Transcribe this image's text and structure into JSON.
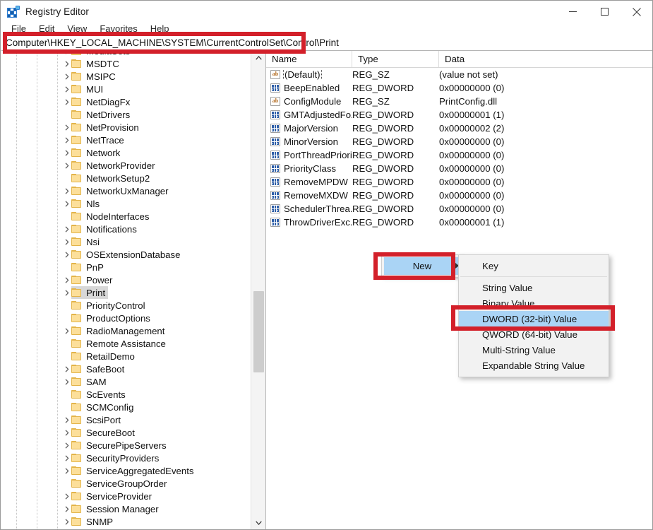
{
  "window": {
    "title": "Registry Editor",
    "icon": "registry-editor-icon",
    "minimize_label": "Minimize",
    "maximize_label": "Maximize",
    "close_label": "Close"
  },
  "menubar": {
    "items": [
      {
        "label": "File"
      },
      {
        "label": "Edit"
      },
      {
        "label": "View"
      },
      {
        "label": "Favorites"
      },
      {
        "label": "Help"
      }
    ]
  },
  "address": {
    "path": "Computer\\HKEY_LOCAL_MACHINE\\SYSTEM\\CurrentControlSet\\Control\\Print"
  },
  "tree": {
    "items": [
      {
        "label": "MediaSets",
        "expandable": true,
        "selected": false,
        "partial": true
      },
      {
        "label": "MSDTC",
        "expandable": true,
        "selected": false
      },
      {
        "label": "MSIPC",
        "expandable": true,
        "selected": false
      },
      {
        "label": "MUI",
        "expandable": true,
        "selected": false
      },
      {
        "label": "NetDiagFx",
        "expandable": true,
        "selected": false
      },
      {
        "label": "NetDrivers",
        "expandable": false,
        "selected": false
      },
      {
        "label": "NetProvision",
        "expandable": true,
        "selected": false
      },
      {
        "label": "NetTrace",
        "expandable": true,
        "selected": false
      },
      {
        "label": "Network",
        "expandable": true,
        "selected": false
      },
      {
        "label": "NetworkProvider",
        "expandable": true,
        "selected": false
      },
      {
        "label": "NetworkSetup2",
        "expandable": false,
        "selected": false
      },
      {
        "label": "NetworkUxManager",
        "expandable": true,
        "selected": false
      },
      {
        "label": "Nls",
        "expandable": true,
        "selected": false
      },
      {
        "label": "NodeInterfaces",
        "expandable": false,
        "selected": false
      },
      {
        "label": "Notifications",
        "expandable": true,
        "selected": false
      },
      {
        "label": "Nsi",
        "expandable": true,
        "selected": false
      },
      {
        "label": "OSExtensionDatabase",
        "expandable": true,
        "selected": false
      },
      {
        "label": "PnP",
        "expandable": false,
        "selected": false
      },
      {
        "label": "Power",
        "expandable": true,
        "selected": false
      },
      {
        "label": "Print",
        "expandable": true,
        "selected": true
      },
      {
        "label": "PriorityControl",
        "expandable": false,
        "selected": false
      },
      {
        "label": "ProductOptions",
        "expandable": false,
        "selected": false
      },
      {
        "label": "RadioManagement",
        "expandable": true,
        "selected": false
      },
      {
        "label": "Remote Assistance",
        "expandable": false,
        "selected": false
      },
      {
        "label": "RetailDemo",
        "expandable": false,
        "selected": false
      },
      {
        "label": "SafeBoot",
        "expandable": true,
        "selected": false
      },
      {
        "label": "SAM",
        "expandable": true,
        "selected": false
      },
      {
        "label": "ScEvents",
        "expandable": false,
        "selected": false
      },
      {
        "label": "SCMConfig",
        "expandable": false,
        "selected": false
      },
      {
        "label": "ScsiPort",
        "expandable": true,
        "selected": false
      },
      {
        "label": "SecureBoot",
        "expandable": true,
        "selected": false
      },
      {
        "label": "SecurePipeServers",
        "expandable": true,
        "selected": false
      },
      {
        "label": "SecurityProviders",
        "expandable": true,
        "selected": false
      },
      {
        "label": "ServiceAggregatedEvents",
        "expandable": true,
        "selected": false
      },
      {
        "label": "ServiceGroupOrder",
        "expandable": false,
        "selected": false
      },
      {
        "label": "ServiceProvider",
        "expandable": true,
        "selected": false
      },
      {
        "label": "Session Manager",
        "expandable": true,
        "selected": false
      },
      {
        "label": "SNMP",
        "expandable": true,
        "selected": false,
        "partial": true
      }
    ],
    "scrollbar": {
      "up_arrow": "chevron-up",
      "down_arrow": "chevron-down"
    }
  },
  "values": {
    "columns": [
      "Name",
      "Type",
      "Data"
    ],
    "rows": [
      {
        "name": "(Default)",
        "type": "REG_SZ",
        "data": "(value not set)",
        "icon": "string-value-icon",
        "focused": true
      },
      {
        "name": "BeepEnabled",
        "type": "REG_DWORD",
        "data": "0x00000000 (0)",
        "icon": "dword-value-icon",
        "focused": false
      },
      {
        "name": "ConfigModule",
        "type": "REG_SZ",
        "data": "PrintConfig.dll",
        "icon": "string-value-icon",
        "focused": false
      },
      {
        "name": "GMTAdjustedFo...",
        "type": "REG_DWORD",
        "data": "0x00000001 (1)",
        "icon": "dword-value-icon",
        "focused": false
      },
      {
        "name": "MajorVersion",
        "type": "REG_DWORD",
        "data": "0x00000002 (2)",
        "icon": "dword-value-icon",
        "focused": false
      },
      {
        "name": "MinorVersion",
        "type": "REG_DWORD",
        "data": "0x00000000 (0)",
        "icon": "dword-value-icon",
        "focused": false
      },
      {
        "name": "PortThreadPriority",
        "type": "REG_DWORD",
        "data": "0x00000000 (0)",
        "icon": "dword-value-icon",
        "focused": false
      },
      {
        "name": "PriorityClass",
        "type": "REG_DWORD",
        "data": "0x00000000 (0)",
        "icon": "dword-value-icon",
        "focused": false
      },
      {
        "name": "RemoveMPDW",
        "type": "REG_DWORD",
        "data": "0x00000000 (0)",
        "icon": "dword-value-icon",
        "focused": false
      },
      {
        "name": "RemoveMXDW",
        "type": "REG_DWORD",
        "data": "0x00000000 (0)",
        "icon": "dword-value-icon",
        "focused": false
      },
      {
        "name": "SchedulerThrea...",
        "type": "REG_DWORD",
        "data": "0x00000000 (0)",
        "icon": "dword-value-icon",
        "focused": false
      },
      {
        "name": "ThrowDriverExc...",
        "type": "REG_DWORD",
        "data": "0x00000001 (1)",
        "icon": "dword-value-icon",
        "focused": false
      }
    ]
  },
  "context_menu": {
    "parent_label": "New",
    "submenu_arrow": "▶",
    "submenu_items": [
      {
        "label": "Key",
        "highlighted": false,
        "separator_after": true
      },
      {
        "label": "String Value",
        "highlighted": false,
        "separator_after": false
      },
      {
        "label": "Binary Value",
        "highlighted": false,
        "separator_after": false
      },
      {
        "label": "DWORD (32-bit) Value",
        "highlighted": true,
        "separator_after": false
      },
      {
        "label": "QWORD (64-bit) Value",
        "highlighted": false,
        "separator_after": false
      },
      {
        "label": "Multi-String Value",
        "highlighted": false,
        "separator_after": false
      },
      {
        "label": "Expandable String Value",
        "highlighted": false,
        "separator_after": false
      }
    ]
  },
  "annotations": {
    "color": "#d3202a",
    "boxes": [
      {
        "target": "address-bar"
      },
      {
        "target": "new-menu-item"
      },
      {
        "target": "dword-menu-item"
      }
    ]
  },
  "colors": {
    "highlight_blue": "#aad4f5",
    "selection_gray": "#d8d8d8",
    "menu_bg": "#f2f2f2",
    "annotation_red": "#d3202a"
  }
}
